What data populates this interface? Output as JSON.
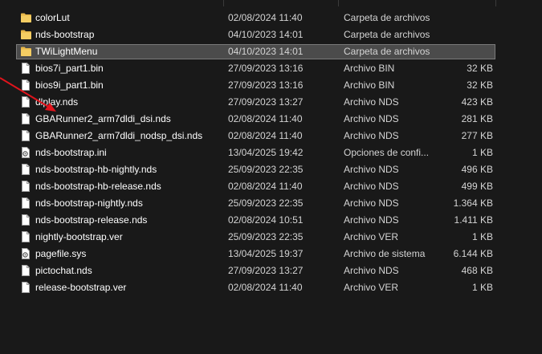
{
  "files": [
    {
      "name": "colorLut",
      "date": "02/08/2024 11:40",
      "type": "Carpeta de archivos",
      "size": "",
      "kind": "folder-icon",
      "selected": false
    },
    {
      "name": "nds-bootstrap",
      "date": "04/10/2023 14:01",
      "type": "Carpeta de archivos",
      "size": "",
      "kind": "folder-icon",
      "selected": false
    },
    {
      "name": "TWiLightMenu",
      "date": "04/10/2023 14:01",
      "type": "Carpeta de archivos",
      "size": "",
      "kind": "folder-icon",
      "selected": true
    },
    {
      "name": "bios7i_part1.bin",
      "date": "27/09/2023 13:16",
      "type": "Archivo BIN",
      "size": "32 KB",
      "kind": "file-icon",
      "selected": false
    },
    {
      "name": "bios9i_part1.bin",
      "date": "27/09/2023 13:16",
      "type": "Archivo BIN",
      "size": "32 KB",
      "kind": "file-icon",
      "selected": false
    },
    {
      "name": "dlplay.nds",
      "date": "27/09/2023 13:27",
      "type": "Archivo NDS",
      "size": "423 KB",
      "kind": "file-icon",
      "selected": false
    },
    {
      "name": "GBARunner2_arm7dldi_dsi.nds",
      "date": "02/08/2024 11:40",
      "type": "Archivo NDS",
      "size": "281 KB",
      "kind": "file-icon",
      "selected": false
    },
    {
      "name": "GBARunner2_arm7dldi_nodsp_dsi.nds",
      "date": "02/08/2024 11:40",
      "type": "Archivo NDS",
      "size": "277 KB",
      "kind": "file-icon",
      "selected": false
    },
    {
      "name": "nds-bootstrap.ini",
      "date": "13/04/2025 19:42",
      "type": "Opciones de confi...",
      "size": "1 KB",
      "kind": "settings-file-icon",
      "selected": false
    },
    {
      "name": "nds-bootstrap-hb-nightly.nds",
      "date": "25/09/2023 22:35",
      "type": "Archivo NDS",
      "size": "496 KB",
      "kind": "file-icon",
      "selected": false
    },
    {
      "name": "nds-bootstrap-hb-release.nds",
      "date": "02/08/2024 11:40",
      "type": "Archivo NDS",
      "size": "499 KB",
      "kind": "file-icon",
      "selected": false
    },
    {
      "name": "nds-bootstrap-nightly.nds",
      "date": "25/09/2023 22:35",
      "type": "Archivo NDS",
      "size": "1.364 KB",
      "kind": "file-icon",
      "selected": false
    },
    {
      "name": "nds-bootstrap-release.nds",
      "date": "02/08/2024 10:51",
      "type": "Archivo NDS",
      "size": "1.411 KB",
      "kind": "file-icon",
      "selected": false
    },
    {
      "name": "nightly-bootstrap.ver",
      "date": "25/09/2023 22:35",
      "type": "Archivo VER",
      "size": "1 KB",
      "kind": "file-icon",
      "selected": false
    },
    {
      "name": "pagefile.sys",
      "date": "13/04/2025 19:37",
      "type": "Archivo de sistema",
      "size": "6.144 KB",
      "kind": "settings-file-icon",
      "selected": false
    },
    {
      "name": "pictochat.nds",
      "date": "27/09/2023 13:27",
      "type": "Archivo NDS",
      "size": "468 KB",
      "kind": "file-icon",
      "selected": false
    },
    {
      "name": "release-bootstrap.ver",
      "date": "02/08/2024 11:40",
      "type": "Archivo VER",
      "size": "1 KB",
      "kind": "file-icon",
      "selected": false
    }
  ],
  "colors": {
    "background": "#191919",
    "selection": "#4b4b4b",
    "folder": "#e8b84a",
    "arrow": "#e0141c"
  }
}
